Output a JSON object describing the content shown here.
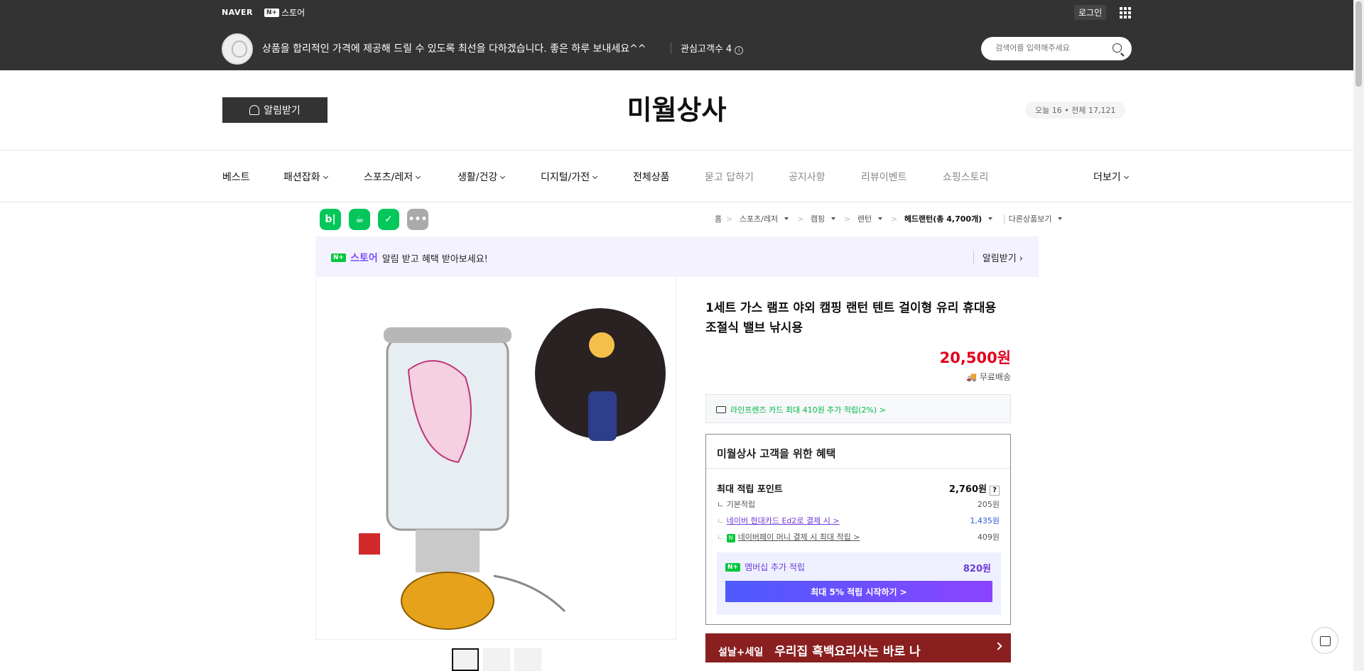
{
  "header": {
    "naver": "NAVER",
    "nplus_badge": "N+",
    "nplus_store": "스토어",
    "login": "로그인",
    "notice": "상품을 합리적인 가격에 제공해 드릴 수 있도록 최선을 다하겠습니다. 좋은 하루 보내세요^^",
    "interest": "관심고객수 4",
    "info_glyph": "i",
    "search_placeholder": "검색어를 입력해주세요"
  },
  "store": {
    "alarm_label": "알림받기",
    "title": "미월상사",
    "visits": "오늘 16 • 전체 17,121"
  },
  "nav": {
    "items": [
      {
        "label": "베스트"
      },
      {
        "label": "패션잡화"
      },
      {
        "label": "스포츠/레저"
      },
      {
        "label": "생활/건강"
      },
      {
        "label": "디지털/가전"
      },
      {
        "label": "전체상품"
      },
      {
        "label": "묻고 답하기"
      },
      {
        "label": "공지사항"
      },
      {
        "label": "리뷰이벤트"
      },
      {
        "label": "쇼핑스토리"
      },
      {
        "label": "더보기"
      }
    ]
  },
  "share_icons": {
    "blog": "b|",
    "talk": "☕",
    "bookmark": "✓",
    "more": "•••"
  },
  "breadcrumb": {
    "home": "홈",
    "c1": "스포츠/레저",
    "c2": "캠핑",
    "c3": "랜턴",
    "current": "헤드랜턴(총 4,700개)",
    "other": "다른상품보기",
    "sep": ">"
  },
  "promo": {
    "badge": "N+",
    "store": "스토어",
    "text": "알림 받고 혜택 받아보세요!",
    "right": "알림받기"
  },
  "product": {
    "title": "1세트 가스 램프 야외 캠핑 랜턴 텐트 걸이형 유리 휴대용 조절식 밸브 낚시용",
    "price": "20,500원",
    "shipping": "무료배송",
    "card_offer": "라인프렌즈 카드 최대 410원 추가 적립(2%) >"
  },
  "benefits": {
    "title": "미월상사 고객을 위한 혜택",
    "max_point_label": "최대 적립 포인트",
    "max_point_value": "2,760원",
    "q": "?",
    "rows": [
      {
        "label": "ㄴ 기본적립",
        "value": "205원"
      },
      {
        "label": "네이버 현대카드 Ed2로 결제 시 >",
        "value": "1,435원"
      },
      {
        "label": "네이버페이 머니 결제 시 최대 적립 >",
        "value": "409원"
      }
    ],
    "np_icon": "N",
    "member_badge": "N+",
    "member_label": "멤버십 추가 적립",
    "member_value": "820원",
    "member_button": "최대 5% 적립 시작하기 >"
  },
  "sale_banner": {
    "small": "설날+세일",
    "main": "우리집 흑백요리사는 바로 나"
  },
  "colors": {
    "accent_purple": "#6d3bd8",
    "price_red": "#e3001b",
    "naver_green": "#03c75a"
  }
}
